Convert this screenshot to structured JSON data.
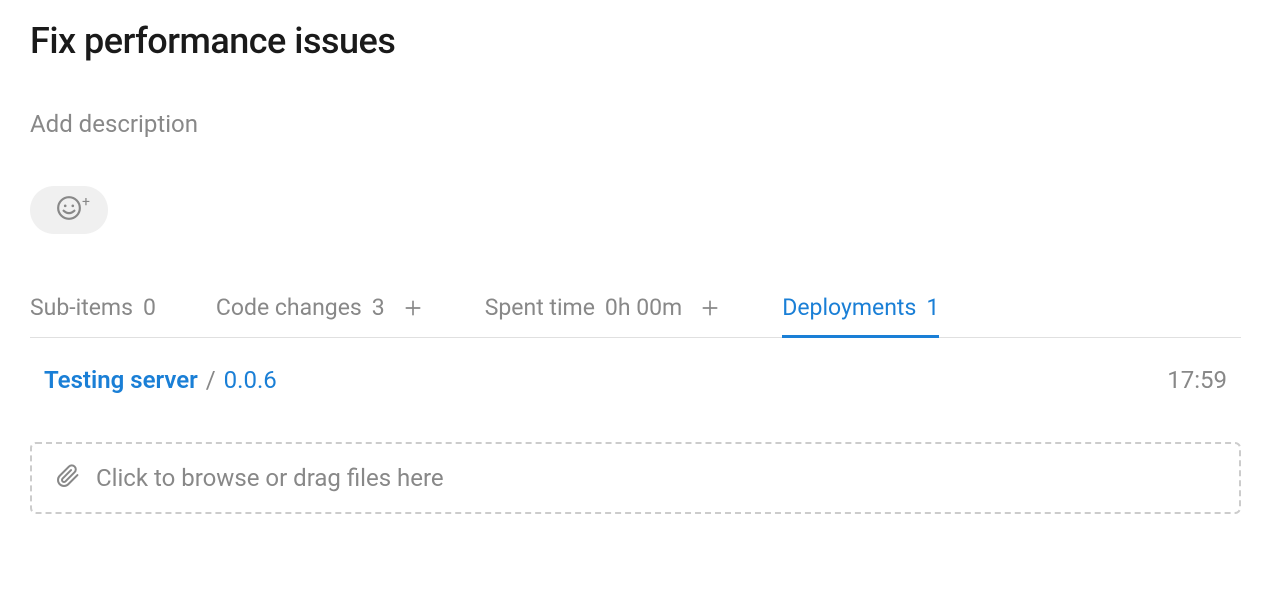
{
  "issue": {
    "title": "Fix performance issues",
    "description_placeholder": "Add description"
  },
  "tabs": {
    "sub_items": {
      "label": "Sub-items",
      "count": "0"
    },
    "code_changes": {
      "label": "Code changes",
      "count": "3"
    },
    "spent_time": {
      "label": "Spent time",
      "value": "0h 00m"
    },
    "deployments": {
      "label": "Deployments",
      "count": "1"
    }
  },
  "deployment": {
    "server": "Testing server",
    "separator": "/",
    "version": "0.0.6",
    "time": "17:59"
  },
  "file_drop": {
    "text": "Click to browse or drag files here"
  }
}
